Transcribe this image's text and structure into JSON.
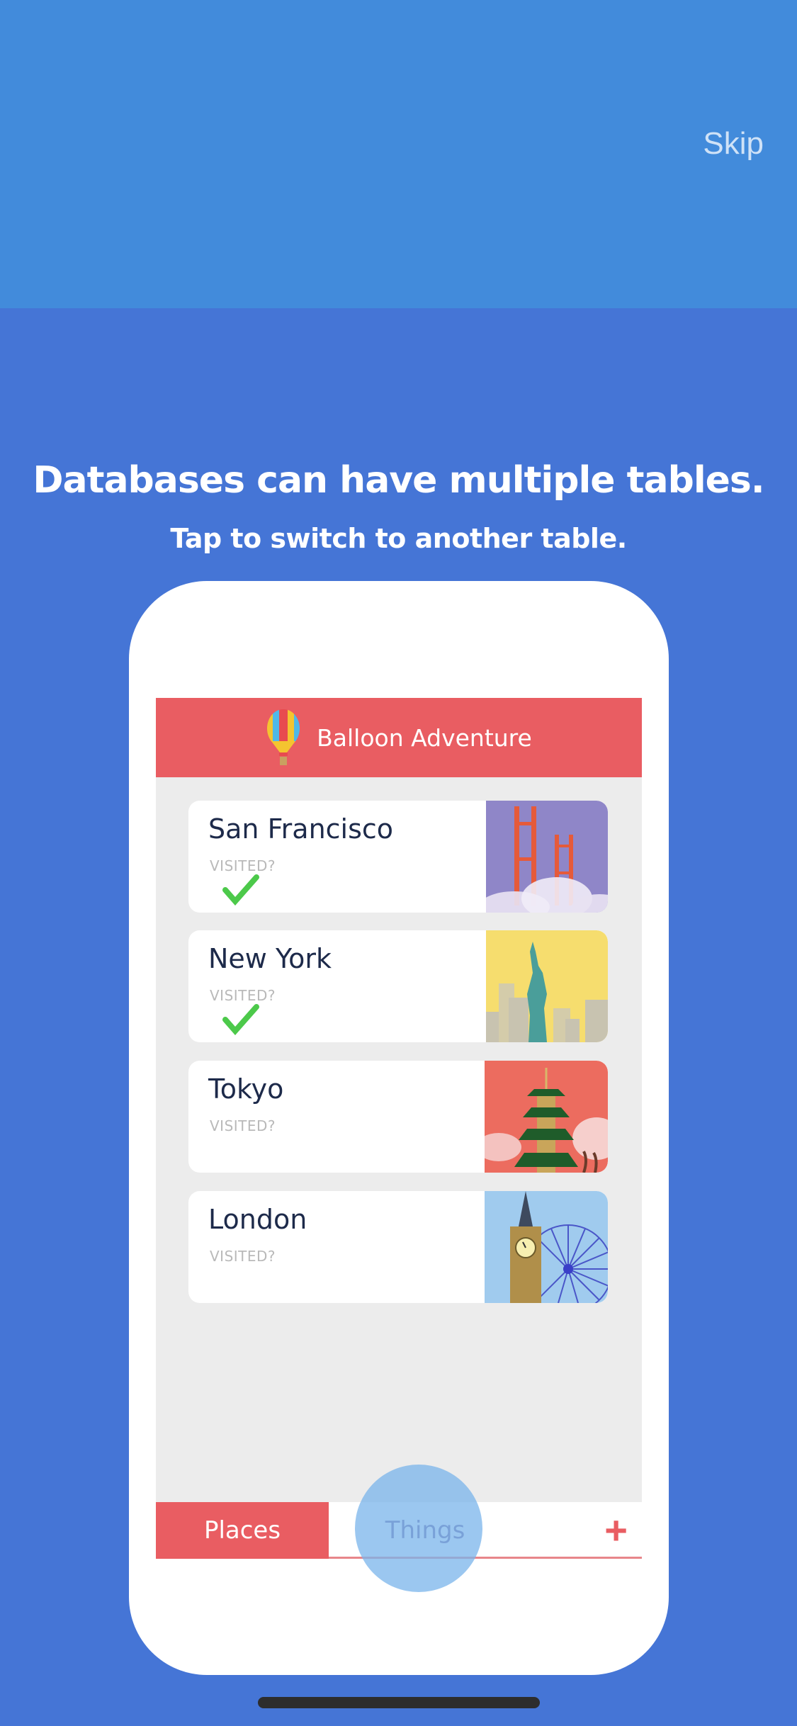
{
  "top": {
    "skip_label": "Skip"
  },
  "onboarding": {
    "headline": "Databases can have multiple tables.",
    "subline": "Tap to switch to another table."
  },
  "app": {
    "title": "Balloon Adventure",
    "logo_icon": "hot-air-balloon-icon",
    "records": [
      {
        "name": "San Francisco",
        "field_label": "VISITED?",
        "visited": true,
        "image": "golden-gate-bridge"
      },
      {
        "name": "New York",
        "field_label": "VISITED?",
        "visited": true,
        "image": "statue-of-liberty"
      },
      {
        "name": "Tokyo",
        "field_label": "VISITED?",
        "visited": false,
        "image": "pagoda"
      },
      {
        "name": "London",
        "field_label": "VISITED?",
        "visited": false,
        "image": "big-ben-london-eye"
      }
    ],
    "tabs": [
      {
        "label": "Places",
        "active": true
      },
      {
        "label": "Things",
        "active": false
      }
    ],
    "add_label": "+"
  },
  "colors": {
    "top_band": "#428bdb",
    "background": "#4575d6",
    "app_accent": "#e95d62",
    "check_green": "#4cc94a"
  }
}
